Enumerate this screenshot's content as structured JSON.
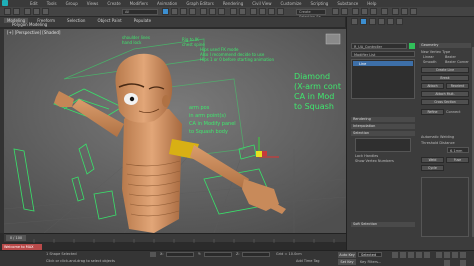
{
  "menubar": {
    "items": [
      "Edit",
      "Tools",
      "Group",
      "Views",
      "Create",
      "Modifiers",
      "Animation",
      "Graph Editors",
      "Rendering",
      "Civil View",
      "Customize",
      "Scripting",
      "Substance",
      "Help"
    ]
  },
  "toolbar": {
    "selection_filter": "All",
    "named_selection": "Create Selection Se"
  },
  "ribbon": {
    "tabs": [
      "Modeling",
      "Freeform",
      "Selection",
      "Object Paint",
      "Populate"
    ],
    "sub_label": "Polygon Modeling"
  },
  "viewport": {
    "label": "[+] [Perspective] [Shaded]",
    "annotations": {
      "left_note": [
        "shoulder lines",
        "hand lock"
      ],
      "center_lines": [
        "Rig to IK",
        "chest spine",
        "Hips used FK mode",
        "Also I recommend decide to use",
        "Hips 1 or 0 before starting animation"
      ],
      "lower_lines": [
        "arm pos",
        "in arm point(s)",
        "CA in Modify panel",
        "to Squash body"
      ],
      "right_big": [
        "Diamond",
        "(X-arm cont",
        "CA in Mod",
        "to Squash"
      ]
    }
  },
  "command_panel": {
    "object_name": "R_UA_Controller",
    "modifier_list_label": "Modifier List",
    "stack_items": [
      "Line"
    ],
    "rollouts": [
      "Rendering",
      "Interpolation",
      "Selection",
      "Soft Selection",
      "Geometry"
    ],
    "geometry_section": {
      "title": "Geometry",
      "new_vertex_type": "New Vertex Type",
      "options": [
        "Linear",
        "Smooth",
        "Bezier",
        "Bezier Corner"
      ],
      "create_line": "Create Line",
      "break": "Break",
      "attach": "Attach",
      "reorient": "Reorient",
      "attach_mult": "Attach Mult.",
      "cross_section": "Cross Section",
      "refine": "Refine",
      "connect": "Connect",
      "auto_welding": "Automatic Welding",
      "threshold_label": "Threshold Distance",
      "threshold_value": "6.1mm",
      "weld": "Weld",
      "fuse": "Fuse",
      "cycle": "Cycle"
    },
    "lock_handles": "Lock Handles",
    "show_vertex_numbers": "Show Vertex Numbers"
  },
  "timeline": {
    "frame_counter": "0 / 100"
  },
  "status": {
    "script_label": "Welcome to MAX",
    "selection_text": "1 Shape Selected",
    "prompt_text": "Click or click-and-drag to select objects",
    "x_label": "X:",
    "y_label": "Y:",
    "z_label": "Z:",
    "grid_text": "Grid = 10.0cm",
    "add_time_tag": "Add Time Tag",
    "auto_key": "Auto Key",
    "set_key": "Set Key",
    "selected_option": "Selected",
    "key_filters": "Key Filters..."
  }
}
